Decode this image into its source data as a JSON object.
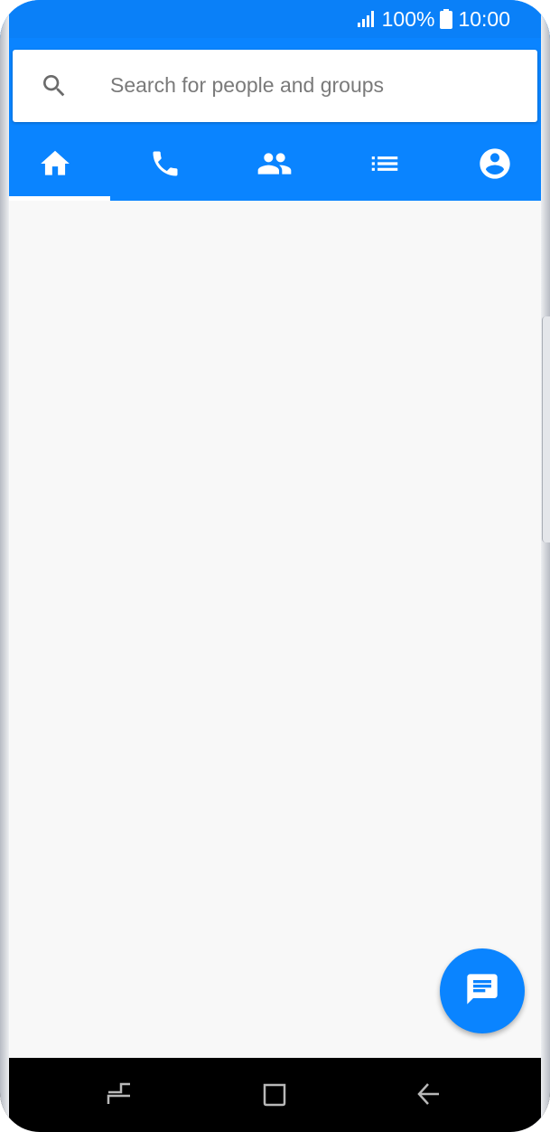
{
  "status_bar": {
    "battery_text": "100%",
    "time": "10:00",
    "icons": [
      "signal-icon",
      "battery-icon"
    ]
  },
  "search": {
    "placeholder": "Search for people and groups",
    "icon": "search-icon"
  },
  "tabs": [
    {
      "icon": "home-icon",
      "selected": true
    },
    {
      "icon": "phone-icon",
      "selected": false
    },
    {
      "icon": "people-icon",
      "selected": false
    },
    {
      "icon": "list-icon",
      "selected": false
    },
    {
      "icon": "account-icon",
      "selected": false
    }
  ],
  "fab": {
    "icon": "message-icon"
  },
  "nav_bar": {
    "icons": [
      "recent-apps-icon",
      "home-button-icon",
      "back-icon"
    ]
  },
  "colors": {
    "primary": "#0a84ff",
    "status_bar": "#0a80f8",
    "background": "#f8f8f8",
    "nav_bar": "#000000"
  }
}
